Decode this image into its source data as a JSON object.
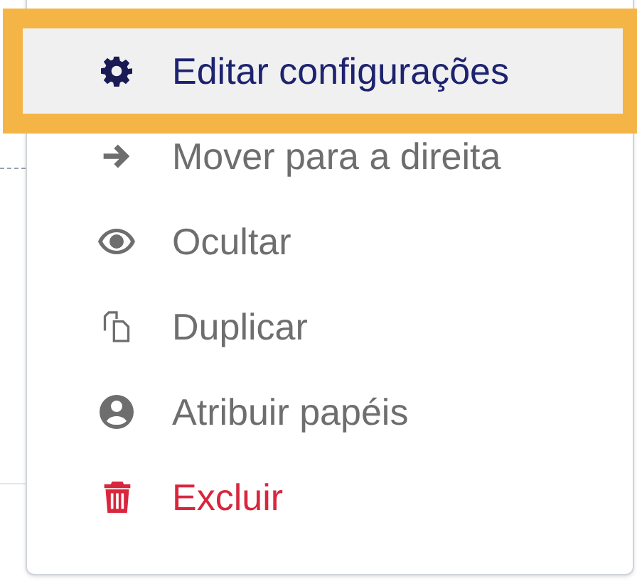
{
  "menu": {
    "items": [
      {
        "label": "Editar configurações",
        "kind": "settings",
        "selected": true
      },
      {
        "label": "Mover para a direita",
        "kind": "move",
        "selected": false
      },
      {
        "label": "Ocultar",
        "kind": "hide",
        "selected": false
      },
      {
        "label": "Duplicar",
        "kind": "duplicate",
        "selected": false
      },
      {
        "label": "Atribuir papéis",
        "kind": "roles",
        "selected": false
      },
      {
        "label": "Excluir",
        "kind": "delete",
        "selected": false
      }
    ]
  }
}
